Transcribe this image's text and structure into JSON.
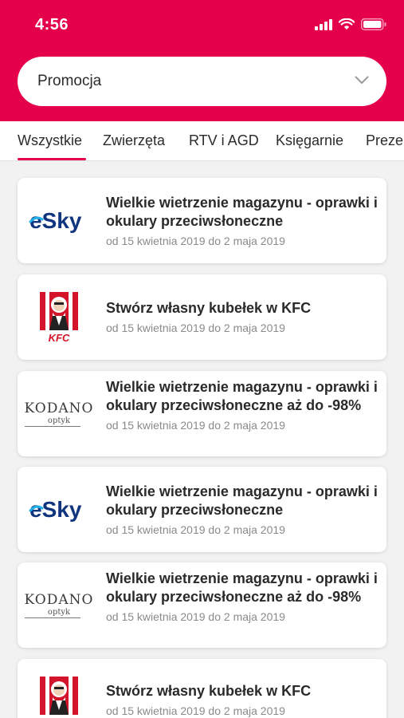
{
  "status": {
    "time": "4:56"
  },
  "filter": {
    "label": "Promocja"
  },
  "tabs": [
    "Wszystkie",
    "Zwierzęta",
    "RTV i AGD",
    "Księgarnie",
    "Prezenty"
  ],
  "brands": {
    "esky": "eSky",
    "kfc": "KFC",
    "kodano": "KODANO",
    "kodano_sub": "optyk"
  },
  "offers": [
    {
      "brand": "eSky",
      "title": "Wielkie wietrzenie magazynu - oprawki i okulary przeciwsłoneczne",
      "date": "od 15 kwietnia 2019 do 2 maja 2019"
    },
    {
      "brand": "KFC",
      "title": "Stwórz własny kubełek w KFC",
      "date": "od 15 kwietnia 2019 do 2 maja 2019"
    },
    {
      "brand": "KODANO",
      "title": "Wielkie wietrzenie magazynu - oprawki i okulary przeciwsłoneczne aż do -98%",
      "date": "od 15 kwietnia 2019 do 2 maja 2019"
    },
    {
      "brand": "eSky",
      "title": "Wielkie wietrzenie magazynu - oprawki i okulary przeciwsłoneczne",
      "date": "od 15 kwietnia 2019 do 2 maja 2019"
    },
    {
      "brand": "KODANO",
      "title": "Wielkie wietrzenie magazynu - oprawki i okulary przeciwsłoneczne aż do -98%",
      "date": "od 15 kwietnia 2019 do 2 maja 2019"
    },
    {
      "brand": "KFC",
      "title": "Stwórz własny kubełek w KFC",
      "date": "od 15 kwietnia 2019 do 2 maja 2019"
    }
  ],
  "colors": {
    "accent": "#e4004b",
    "esky_blue": "#10357e",
    "kfc_red": "#d3142a"
  }
}
